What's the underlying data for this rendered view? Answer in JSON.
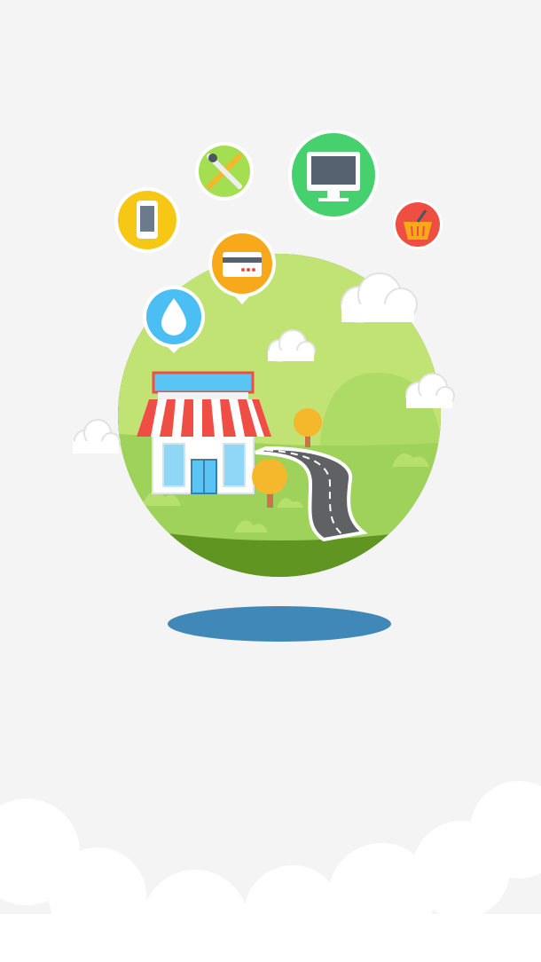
{
  "illustration": {
    "colors": {
      "background": "#f4f4f4",
      "globe_light": "#c1e374",
      "globe_mid": "#9fd25b",
      "globe_base": "#4f7f14",
      "shadow": "#3f88b8",
      "road": "#606165",
      "awning_red": "#ee4e44",
      "sign_blue": "#58c5f5",
      "tree": "#f5b82c",
      "phone_bubble": "#f6c714",
      "tools_bubble": "#a4df51",
      "monitor_bubble": "#46d06e",
      "basket_bubble": "#ee4f42",
      "card_bubble": "#f7a81b",
      "water_bubble": "#4bbef4"
    },
    "icons": [
      "phone-icon",
      "tools-icon",
      "monitor-icon",
      "basket-icon",
      "card-icon",
      "water-drop-icon"
    ]
  }
}
